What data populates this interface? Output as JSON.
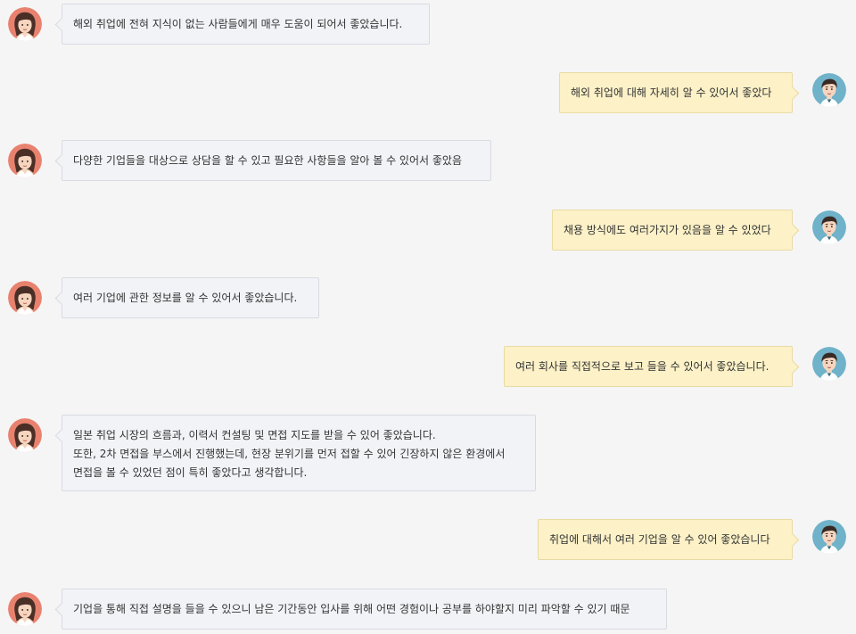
{
  "messages": [
    {
      "side": "left",
      "lines": [
        "해외 취업에 전혀 지식이 없는 사람들에게 매우 도움이 되어서 좋았습니다."
      ]
    },
    {
      "side": "right",
      "lines": [
        "해외 취업에 대해 자세히 알 수 있어서 좋았다"
      ]
    },
    {
      "side": "left",
      "lines": [
        "다양한 기업들을 대상으로 상담을 할 수 있고 필요한 사항들을 알아 볼 수 있어서 좋았음"
      ]
    },
    {
      "side": "right",
      "lines": [
        "채용 방식에도 여러가지가 있음을 알 수 있었다"
      ]
    },
    {
      "side": "left",
      "lines": [
        "여러 기업에 관한 정보를 알 수 있어서 좋았습니다."
      ]
    },
    {
      "side": "right",
      "lines": [
        "여러 회사를 직접적으로 보고 들을 수 있어서 좋았습니다."
      ]
    },
    {
      "side": "left",
      "lines": [
        "일본 취업 시장의 흐름과, 이력서 컨설팅 및 면접 지도를 받을 수 있어 좋았습니다.",
        "또한, 2차 면접을 부스에서 진행했는데, 현장 분위기를 먼저 접할 수 있어 긴장하지 않은 환경에서",
        "면접을 볼 수 있었던 점이 특히 좋았다고 생각합니다."
      ]
    },
    {
      "side": "right",
      "lines": [
        "취업에 대해서 여러 기업을 알 수 있어 좋았습니다"
      ]
    },
    {
      "side": "left",
      "lines": [
        "기업을 통해 직접 설명을 들을 수 있으니 남은 기간동안 입사를 위해 어떤 경험이나 공부를 하야할지 미리 파악할 수 있기 때문"
      ]
    }
  ],
  "avatars": {
    "left": "female-avatar-icon",
    "right": "male-avatar-icon"
  },
  "colors": {
    "background": "#f5f5f5",
    "left_bubble": "#f2f3f7",
    "left_border": "#d9dbe2",
    "right_bubble": "#fcf1c7",
    "right_border": "#e8dba3",
    "female_avatar_bg": "#e8826f",
    "male_avatar_bg": "#6fb2c9"
  }
}
